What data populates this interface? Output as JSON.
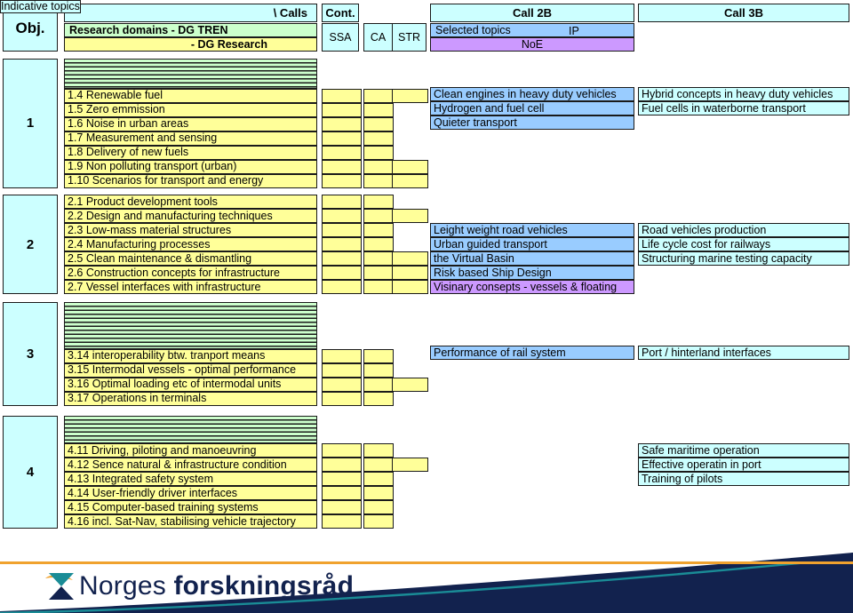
{
  "header": {
    "obj_label": "Obj.",
    "calls_label": "\\ Calls",
    "domains_dgtren": "Research domains  -  DG TREN",
    "domains_dgresearch": "-  DG Research",
    "cont_label": "Cont.",
    "instruments": [
      "SSA",
      "CA",
      "STR"
    ],
    "call2b_label": "Call 2B",
    "selected_topics_label": "Selected topics",
    "ip_label": "IP",
    "noe_label": "NoE",
    "call3b_label": "Call 3B",
    "indicative_topics_label": "Indicative topics"
  },
  "colors": {
    "cyan": "#ccffff",
    "green": "#ccffcc",
    "yellow": "#ffff99",
    "blue": "#99ccff",
    "purple": "#cc99ff",
    "border": "#1a1a1a",
    "brand_orange": "#f0a22e",
    "brand_navy": "#12224e",
    "brand_teal": "#1a8c96"
  },
  "sections": [
    {
      "number": "1",
      "topics": [
        "1.4 Renewable fuel",
        "1.5 Zero emmission",
        "1.6 Noise in urban areas",
        "1.7 Measurement and sensing",
        "1.8 Delivery of new fuels",
        "1.9 Non polluting transport (urban)",
        "1.10 Scenarios for transport and energy"
      ],
      "call2b": [
        {
          "text": "Clean engines in heavy duty vehicles",
          "kind": "ip"
        },
        {
          "text": "Hydrogen and fuel cell",
          "kind": "ip"
        },
        {
          "text": "Quieter transport",
          "kind": "ip"
        }
      ],
      "call3b": [
        "Hybrid concepts in heavy duty vehicles",
        "Fuel cells in waterborne transport"
      ]
    },
    {
      "number": "2",
      "topics": [
        "2.1 Product development tools",
        "2.2 Design and manufacturing techniques",
        "2.3 Low-mass material structures",
        "2.4 Manufacturing processes",
        "2.5 Clean maintenance & dismantling",
        "2.6 Construction concepts for infrastructure",
        "2.7 Vessel interfaces with infrastructure"
      ],
      "call2b": [
        {
          "text": "Leight weight road vehicles",
          "kind": "ip"
        },
        {
          "text": "Urban guided transport",
          "kind": "ip"
        },
        {
          "text": "the Virtual Basin",
          "kind": "ip"
        },
        {
          "text": "Risk based Ship Design",
          "kind": "ip"
        },
        {
          "text": "Visinary consepts - vessels & floating",
          "kind": "noe"
        }
      ],
      "call3b": [
        "Road vehicles production",
        "Life cycle cost for railways",
        "Structuring marine testing capacity"
      ]
    },
    {
      "number": "3",
      "topics": [
        "3.14 interoperability btw. tranport means",
        "3.15 Intermodal vessels - optimal performance",
        "3.16 Optimal loading etc of intermodal units",
        "3.17 Operations in terminals"
      ],
      "call2b": [
        {
          "text": "Performance of rail system",
          "kind": "ip"
        }
      ],
      "call3b": [
        "Port / hinterland interfaces"
      ]
    },
    {
      "number": "4",
      "topics": [
        "4.11 Driving, piloting and manoeuvring",
        "4.12 Sence natural & infrastructure condition",
        "4.13 Integrated safety system",
        "4.14 User-friendly driver interfaces",
        "4.15 Computer-based training systems",
        "4.16  incl. Sat-Nav, stabilising vehicle trajectory"
      ],
      "call2b": [],
      "call3b": [
        "Safe maritime operation",
        "Effective operatin in port",
        "Training of pilots"
      ]
    }
  ],
  "footer": {
    "logo_text_light": "Norges ",
    "logo_text_bold": "forskningsråd"
  }
}
